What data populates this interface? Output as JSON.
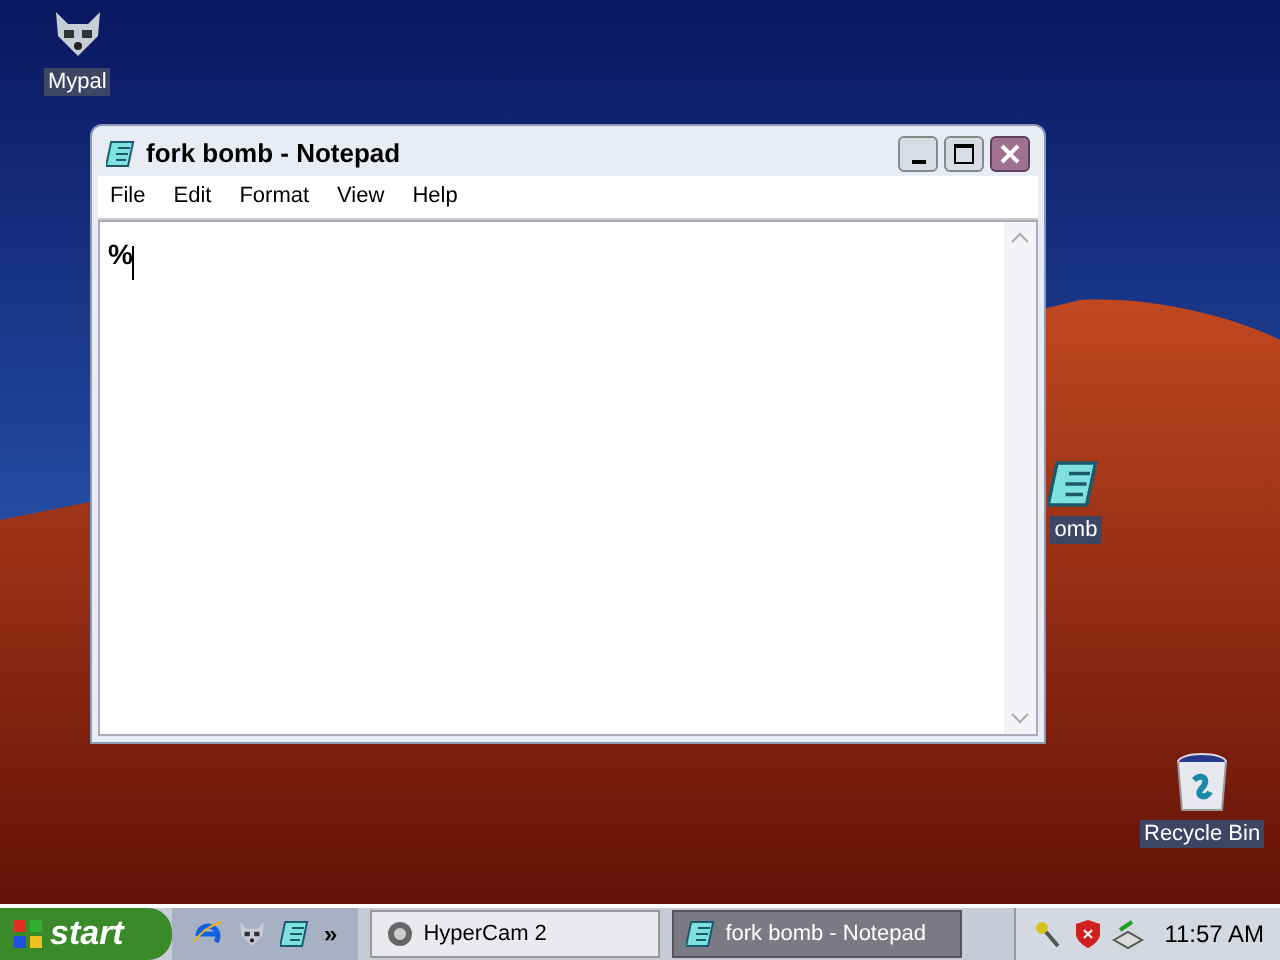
{
  "desktop_icons": [
    {
      "kind": "raccoon",
      "label": "Mypal"
    },
    {
      "kind": "notepad",
      "label": "omb"
    },
    {
      "kind": "bin",
      "label": "Recycle Bin"
    }
  ],
  "window": {
    "title": "fork bomb - Notepad",
    "menu": [
      "File",
      "Edit",
      "Format",
      "View",
      "Help"
    ],
    "text": "%"
  },
  "taskbar": {
    "start": "start",
    "chevron": "»",
    "tasks": [
      {
        "kind": "camera",
        "label": "HyperCam 2",
        "selected": false
      },
      {
        "kind": "notepad",
        "label": "fork bomb - Notepad",
        "selected": true
      }
    ],
    "clock": "11:57 AM"
  }
}
